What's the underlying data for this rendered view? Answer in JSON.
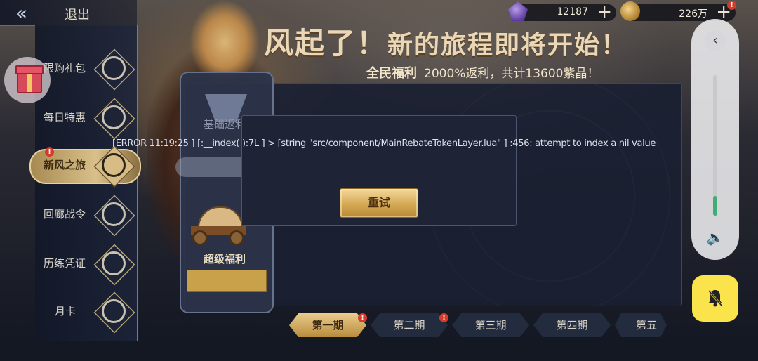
{
  "header": {
    "back_label": "退出",
    "currencies": [
      {
        "icon": "purple-crystal-icon",
        "value": "12187"
      },
      {
        "icon": "gold-coin-icon",
        "value": "226万"
      }
    ]
  },
  "banner": {
    "title_main": "风起了！",
    "title_sub": "新的旅程即将开始！",
    "subtitle_bold": "全民福利",
    "subtitle_detail": "2000%返利，共计13600紫晶！"
  },
  "sidebar": {
    "items": [
      {
        "label": "限购礼包",
        "icon": "gift-icon"
      },
      {
        "label": "每日特惠",
        "icon": "chest-icon"
      },
      {
        "label": "新风之旅",
        "icon": "journey-icon",
        "badge": "!"
      },
      {
        "label": "回廊战令",
        "icon": "wheel-icon"
      },
      {
        "label": "历练凭证",
        "icon": "voucher-icon"
      },
      {
        "label": "月卡",
        "icon": "moon-card-icon"
      }
    ]
  },
  "panel": {
    "tabs": [
      {
        "label": "基础返利"
      },
      {
        "label": "超级福利"
      }
    ]
  },
  "dialog": {
    "error_message": "[ERROR 11:19:25 ] [:__index( ):7L ] > [string \"src/component/MainRebateTokenLayer.lua\" ] :456: attempt to index a nil value",
    "retry_label": "重试"
  },
  "periods": [
    "第一期",
    "第二期",
    "第三期",
    "第四期",
    "第五期"
  ],
  "floating_widget": {
    "volume_level": 0.14
  },
  "colors": {
    "accent_gold": "#d5a954",
    "alert_red": "#d53b2a",
    "mute_yellow": "#fbe34b"
  }
}
